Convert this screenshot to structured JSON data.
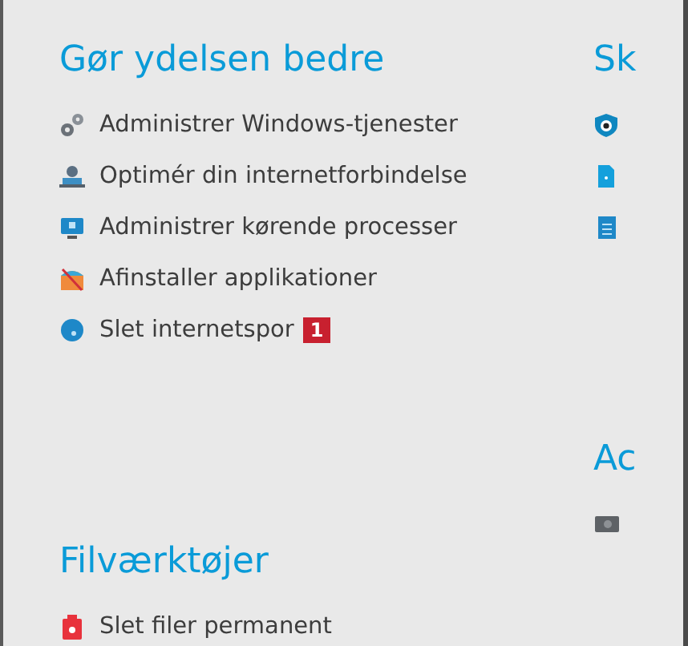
{
  "left_column": [
    {
      "title": "Gør ydelsen bedre",
      "items": [
        {
          "label": "Administrer Windows-tjenester"
        },
        {
          "label": "Optimér din internetforbindelse"
        },
        {
          "label": "Administrer kørende processer"
        },
        {
          "label": "Afinstaller applikationer"
        },
        {
          "label": "Slet internetspor",
          "badge": "1"
        }
      ]
    },
    {
      "title": "Filværktøjer",
      "items": [
        {
          "label": "Slet filer permanent"
        }
      ]
    }
  ],
  "right_column": [
    {
      "title": "Sk"
    },
    {
      "title": "Ac"
    }
  ]
}
